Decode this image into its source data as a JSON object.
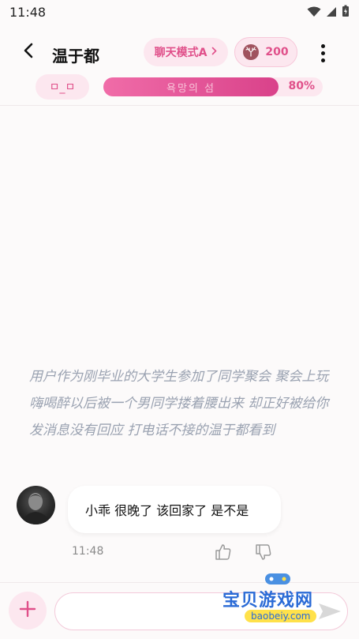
{
  "status_bar": {
    "time": "11:48"
  },
  "header": {
    "back_icon": "chevron-left-icon",
    "title": "温于都",
    "mode_label": "聊天模式A",
    "coins": "200"
  },
  "progress": {
    "emote": "ㅁ_ㅁ",
    "bar_label": "욕망의 섬",
    "percent_text": "80%",
    "value": 0.8,
    "fill_color": "#e0508a"
  },
  "chat": {
    "narration": "用户作为刚毕业的大学生参加了同学聚会 聚会上玩嗨喝醉以后被一个男同学搂着腰出来 却正好被给你发消息没有回应 打电话不接的温于都看到",
    "messages": [
      {
        "text": "小乖 很晚了 该回家了 是不是",
        "time": "11:48"
      }
    ]
  },
  "composer": {
    "value": "",
    "placeholder": ""
  },
  "watermark": {
    "text": "宝贝游戏网",
    "url": "baobeiy.com"
  },
  "colors": {
    "accent": "#e0508a",
    "pill_bg": "#fce7ef",
    "narration": "#9aa2b1"
  }
}
